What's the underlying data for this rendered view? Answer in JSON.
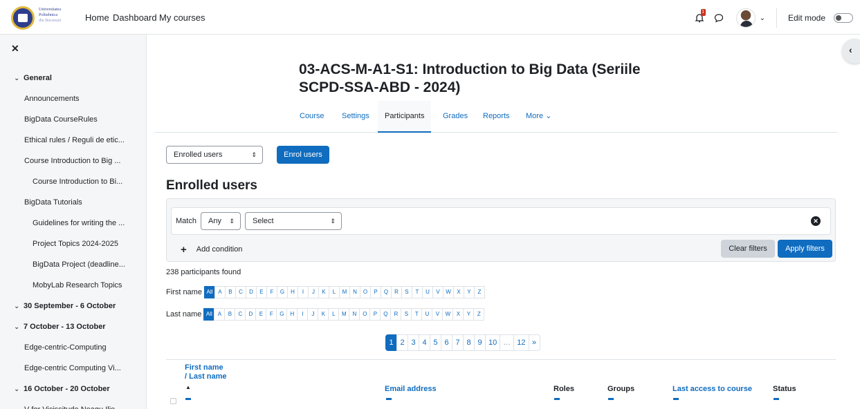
{
  "navbar": {
    "logo_lines": [
      "Universitatea",
      "Politehnica",
      "din București"
    ],
    "links": [
      "Home",
      "Dashboard",
      "My courses"
    ],
    "notification_count": "1",
    "edit_mode_label": "Edit mode",
    "edit_mode_on": false
  },
  "sidebar": {
    "close_icon": "close-icon",
    "items": [
      {
        "label": "General",
        "kind": "section"
      },
      {
        "label": "Announcements",
        "kind": "l1"
      },
      {
        "label": "BigData CourseRules",
        "kind": "l1"
      },
      {
        "label": "Ethical rules / Reguli de etic...",
        "kind": "l1"
      },
      {
        "label": "Course Introduction to Big ...",
        "kind": "l1"
      },
      {
        "label": "Course Introduction to Bi...",
        "kind": "l2"
      },
      {
        "label": "BigData Tutorials",
        "kind": "l1"
      },
      {
        "label": "Guidelines for writing the ...",
        "kind": "l2"
      },
      {
        "label": "Project Topics 2024-2025",
        "kind": "l2"
      },
      {
        "label": "BigData Project (deadline...",
        "kind": "l2"
      },
      {
        "label": "MobyLab Research Topics",
        "kind": "l2"
      },
      {
        "label": "30 September - 6 October",
        "kind": "section"
      },
      {
        "label": "7 October - 13 October",
        "kind": "section"
      },
      {
        "label": "Edge-centric-Computing",
        "kind": "l1"
      },
      {
        "label": "Edge-centric Computing Vi...",
        "kind": "l1"
      },
      {
        "label": "16 October - 20 October",
        "kind": "section"
      },
      {
        "label": "V for Vicissitude Neagu Ilie ...",
        "kind": "l1"
      }
    ]
  },
  "course": {
    "title": "03-ACS-M-A1-S1: Introduction to Big Data (Seriile SCPD-SSA-ABD - 2024)"
  },
  "tabs": [
    {
      "label": "Course"
    },
    {
      "label": "Settings"
    },
    {
      "label": "Participants",
      "active": true
    },
    {
      "label": "Grades"
    },
    {
      "label": "Reports"
    },
    {
      "label": "More ⌄"
    }
  ],
  "page": {
    "selector_value": "Enrolled users",
    "enrol_button": "Enrol users",
    "heading": "Enrolled users"
  },
  "filters": {
    "match_label": "Match",
    "match_value": "Any",
    "select_value": "Select",
    "add_condition": "Add condition",
    "clear_button": "Clear filters",
    "apply_button": "Apply filters"
  },
  "participants_found": "238 participants found",
  "initials": {
    "first_label": "First name",
    "last_label": "Last name",
    "all_label": "All",
    "letters": [
      "A",
      "B",
      "C",
      "D",
      "E",
      "F",
      "G",
      "H",
      "I",
      "J",
      "K",
      "L",
      "M",
      "N",
      "O",
      "P",
      "Q",
      "R",
      "S",
      "T",
      "U",
      "V",
      "W",
      "X",
      "Y",
      "Z"
    ]
  },
  "pagination": [
    "1",
    "2",
    "3",
    "4",
    "5",
    "6",
    "7",
    "8",
    "9",
    "10",
    "…",
    "12",
    "»"
  ],
  "table": {
    "col_name_1": "First name",
    "col_name_2": "/ Last name",
    "sort_icon": "▲",
    "col_email": "Email address",
    "col_roles": "Roles",
    "col_groups": "Groups",
    "col_access": "Last access to course",
    "col_status": "Status"
  },
  "colors": {
    "primary": "#0f6cbf",
    "sidebar_bg": "#f5f6f7",
    "badge": "#ca3120"
  }
}
